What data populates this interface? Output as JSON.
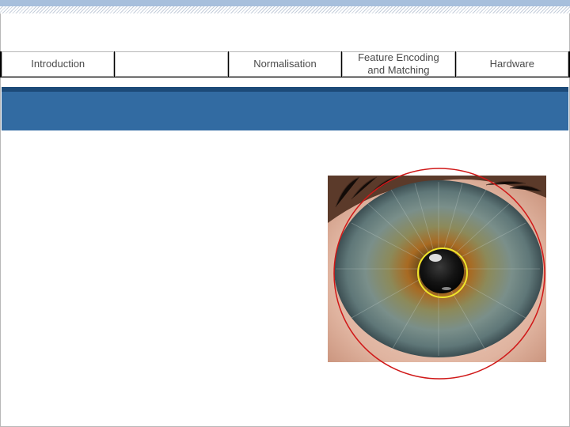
{
  "nav": {
    "tabs": [
      {
        "label": "Introduction"
      },
      {
        "label": ""
      },
      {
        "label": "Normalisation"
      },
      {
        "label": "Feature Encoding\nand Matching"
      },
      {
        "label": "Hardware"
      }
    ]
  },
  "figure": {
    "outer_boundary_color": "#d01818",
    "pupil_boundary_color": "#f0e62a"
  }
}
